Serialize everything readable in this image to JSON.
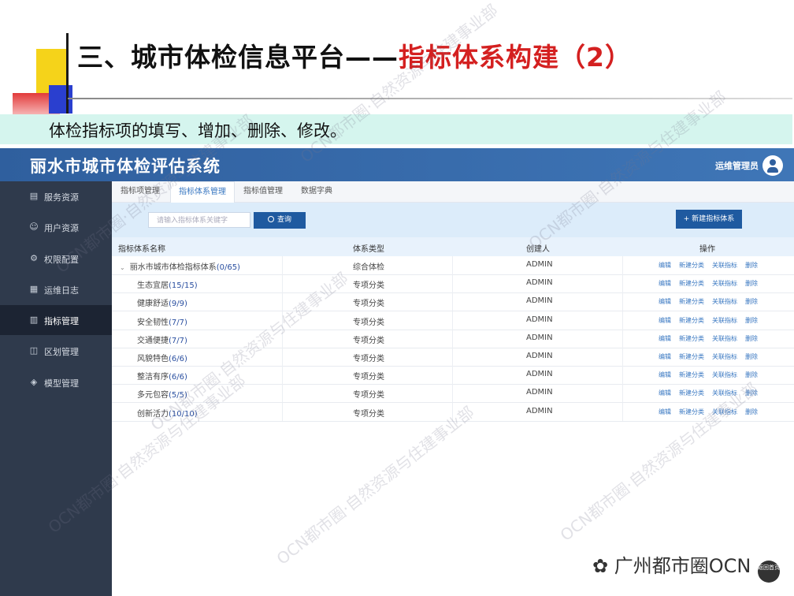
{
  "slide": {
    "title_prefix": "三、城市体检信息平台——",
    "title_highlight": "指标体系构建（2）",
    "subtitle": "体检指标项的填写、增加、删除、修改。"
  },
  "app": {
    "title": "丽水市城市体检评估系统",
    "user_name": "运维管理员"
  },
  "sidebar": {
    "items": [
      {
        "label": "服务资源",
        "icon": "document-icon"
      },
      {
        "label": "用户资源",
        "icon": "user-icon"
      },
      {
        "label": "权限配置",
        "icon": "wrench-icon"
      },
      {
        "label": "运维日志",
        "icon": "log-icon"
      },
      {
        "label": "指标管理",
        "icon": "bar-chart-icon"
      },
      {
        "label": "区划管理",
        "icon": "map-icon"
      },
      {
        "label": "模型管理",
        "icon": "cube-icon"
      }
    ],
    "active_index": 4
  },
  "tabs": [
    "指标项管理",
    "指标体系管理",
    "指标值管理",
    "数据字典"
  ],
  "active_tab": 1,
  "toolbar": {
    "search_placeholder": "请输入指标体系关键字",
    "search_label": "查询",
    "new_label": "+ 新建指标体系"
  },
  "table": {
    "headers": [
      "指标体系名称",
      "体系类型",
      "创建人",
      "操作"
    ],
    "actions": [
      "编辑",
      "新建分类",
      "关联指标",
      "删除"
    ],
    "rows": [
      {
        "name": "丽水市城市体检指标体系",
        "count": "(0/65)",
        "type": "综合体检",
        "creator": "ADMIN",
        "parent": true
      },
      {
        "name": "生态宜居",
        "count": "(15/15)",
        "type": "专项分类",
        "creator": "ADMIN"
      },
      {
        "name": "健康舒适",
        "count": "(9/9)",
        "type": "专项分类",
        "creator": "ADMIN"
      },
      {
        "name": "安全韧性",
        "count": "(7/7)",
        "type": "专项分类",
        "creator": "ADMIN"
      },
      {
        "name": "交通便捷",
        "count": "(7/7)",
        "type": "专项分类",
        "creator": "ADMIN"
      },
      {
        "name": "风貌特色",
        "count": "(6/6)",
        "type": "专项分类",
        "creator": "ADMIN"
      },
      {
        "name": "整洁有序",
        "count": "(6/6)",
        "type": "专项分类",
        "creator": "ADMIN"
      },
      {
        "name": "多元包容",
        "count": "(5/5)",
        "type": "专项分类",
        "creator": "ADMIN"
      },
      {
        "name": "创新活力",
        "count": "(10/10)",
        "type": "专项分类",
        "creator": "ADMIN"
      }
    ]
  },
  "watermark": "OCN都市圈·自然资源与住建事业部",
  "footer": {
    "brand": "广州都市圈OCN",
    "home_label": "返回首页"
  },
  "colors": {
    "header": "#2f5f9e",
    "sidebar": "#2f3a4c",
    "accent": "#1f5aa0",
    "title_red": "#d42020"
  }
}
